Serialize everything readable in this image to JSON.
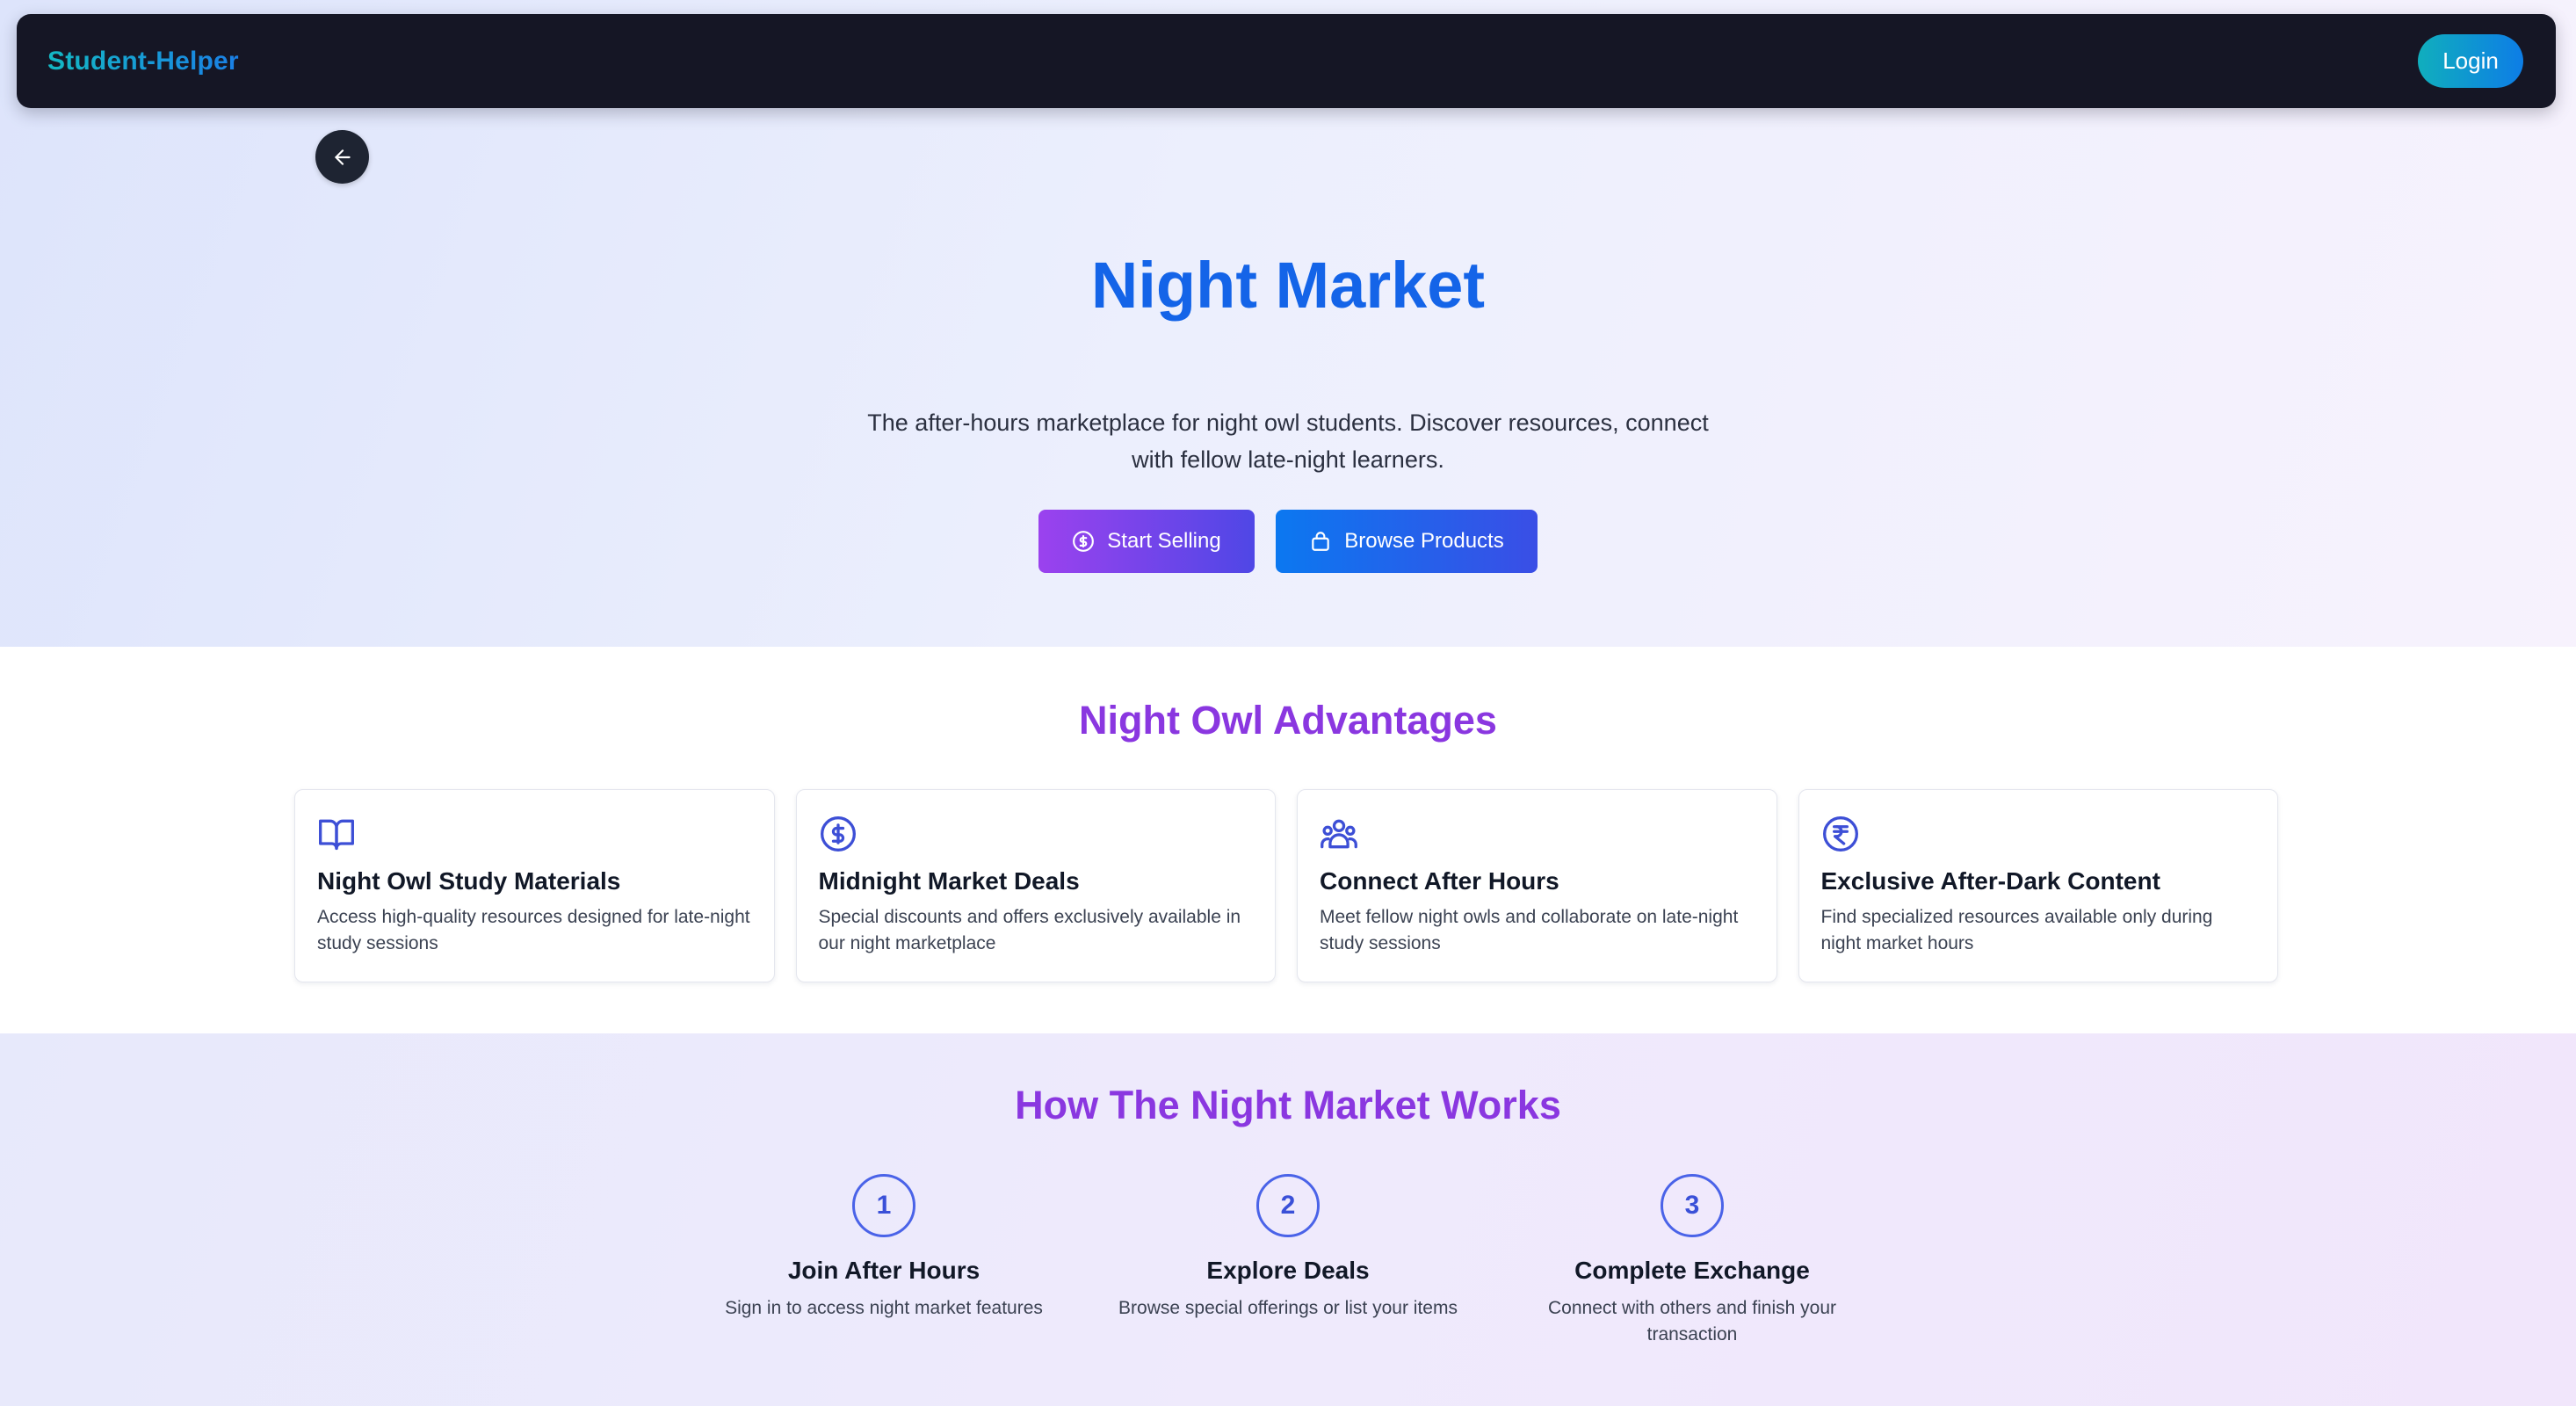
{
  "nav": {
    "brand": "Student-Helper",
    "login_label": "Login"
  },
  "hero": {
    "back_icon": "arrow-left-icon",
    "title": "Night Market",
    "subtitle": "The after-hours marketplace for night owl students. Discover resources, connect with fellow late-night learners.",
    "buttons": [
      {
        "label": "Start Selling",
        "icon": "dollar-circle-icon"
      },
      {
        "label": "Browse Products",
        "icon": "shopping-bag-icon"
      }
    ]
  },
  "advantages": {
    "title": "Night Owl Advantages",
    "cards": [
      {
        "icon": "book-icon",
        "title": "Night Owl Study Materials",
        "desc": "Access high-quality resources designed for late-night study sessions"
      },
      {
        "icon": "dollar-circle-icon",
        "title": "Midnight Market Deals",
        "desc": "Special discounts and offers exclusively available in our night marketplace"
      },
      {
        "icon": "users-icon",
        "title": "Connect After Hours",
        "desc": "Meet fellow night owls and collaborate on late-night study sessions"
      },
      {
        "icon": "rupee-circle-icon",
        "title": "Exclusive After-Dark Content",
        "desc": "Find specialized resources available only during night market hours"
      }
    ]
  },
  "how": {
    "title": "How The Night Market Works",
    "steps": [
      {
        "number": "1",
        "title": "Join After Hours",
        "desc": "Sign in to access night market features"
      },
      {
        "number": "2",
        "title": "Explore Deals",
        "desc": "Browse special offerings or list your items"
      },
      {
        "number": "3",
        "title": "Complete Exchange",
        "desc": "Connect with others and finish your transaction"
      }
    ]
  },
  "colors": {
    "accent_blue": "#1464e8",
    "accent_purple": "#8a37e0",
    "icon_indigo": "#3d4fd6",
    "nav_bg": "#151625"
  }
}
